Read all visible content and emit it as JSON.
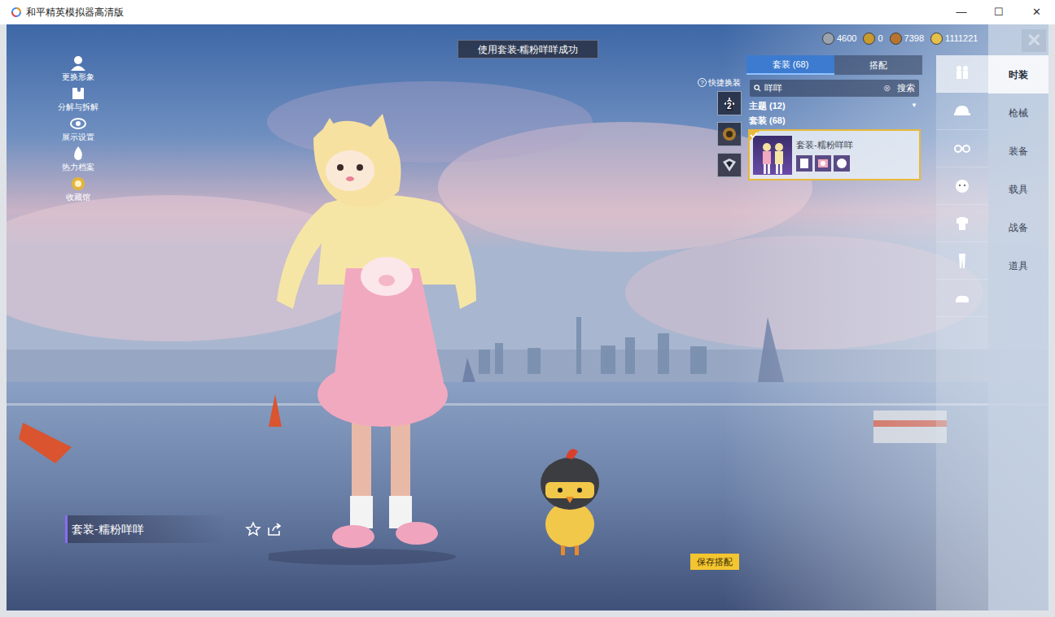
{
  "window": {
    "title": "和平精英模拟器高清版",
    "controls": [
      "—",
      "☐",
      "✕"
    ]
  },
  "toast": "使用套装-糯粉咩咩成功",
  "currencies": [
    {
      "value": "4600",
      "color": "#9aa3ad"
    },
    {
      "value": "0",
      "color": "#c99a2e"
    },
    {
      "value": "7398",
      "color": "#b8742f"
    },
    {
      "value": "1111221",
      "color": "#e6c04a"
    }
  ],
  "close": "✕",
  "left_menu": [
    {
      "label": "更换形象"
    },
    {
      "label": "分解与拆解"
    },
    {
      "label": "展示设置"
    },
    {
      "label": "热力档案"
    },
    {
      "label": "收藏馆"
    }
  ],
  "quick_change": {
    "help": "?",
    "label": "快捷换装",
    "badge": "2"
  },
  "wardrobe": {
    "tabs": [
      {
        "label": "套装 (68)",
        "selected": true
      },
      {
        "label": "搭配",
        "selected": false
      }
    ],
    "search": {
      "value": "咩咩",
      "clear": "⊗",
      "button": "搜索"
    },
    "filters": [
      {
        "label": "主题 (12)",
        "arrow": "▼",
        "expanded": false
      }
    ],
    "section": "套装 (68)",
    "items": [
      {
        "name": "套装-糯粉咩咩",
        "equipped": true,
        "selected": true
      }
    ]
  },
  "category_icons": [
    {
      "selected": true
    },
    {
      "selected": false
    },
    {
      "selected": false
    },
    {
      "selected": false
    },
    {
      "selected": false
    },
    {
      "selected": false
    },
    {
      "selected": false
    }
  ],
  "main_tabs": [
    {
      "label": "时装",
      "selected": true
    },
    {
      "label": "枪械",
      "selected": false
    },
    {
      "label": "装备",
      "selected": false
    },
    {
      "label": "载具",
      "selected": false
    },
    {
      "label": "战备",
      "selected": false
    },
    {
      "label": "道具",
      "selected": false
    }
  ],
  "outfit_name": "套装-糯粉咩咩",
  "save_button": "保存搭配"
}
